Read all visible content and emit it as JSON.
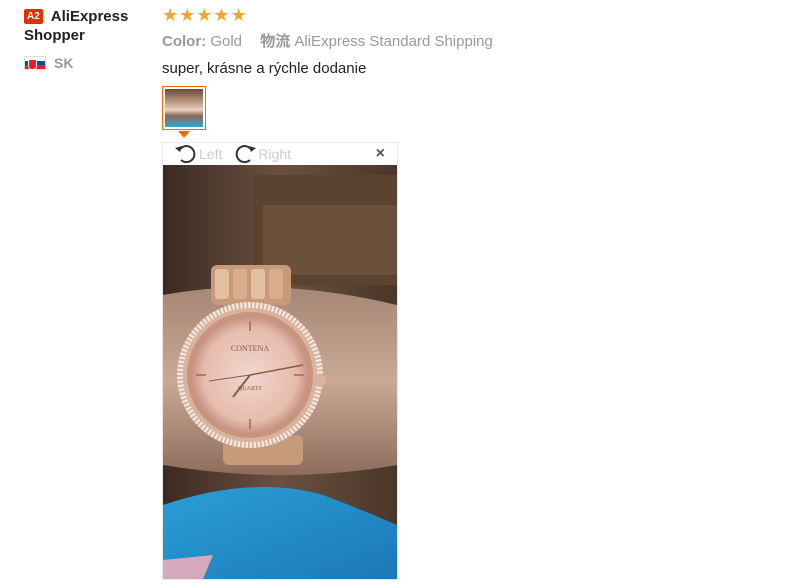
{
  "reviewer": {
    "badge": "A2",
    "name": "AliExpress Shopper",
    "country": "SK",
    "flag_icon": "slovakia-flag-icon"
  },
  "review": {
    "rating": 5,
    "rating_max": 5,
    "color_label": "Color:",
    "color_value": "Gold",
    "shipping_label": "物流",
    "shipping_value": "AliExpress Standard Shipping",
    "text": "super, krásne a rýchle dodanie"
  },
  "viewer": {
    "rotate_left_label": "Left",
    "rotate_right_label": "Right",
    "close_label": "×",
    "watch_brand": "CONTENA",
    "watch_movement": "QUARTZ"
  },
  "colors": {
    "accent": "#ff6600",
    "star": "#f5a623",
    "badge": "#e62e04"
  }
}
